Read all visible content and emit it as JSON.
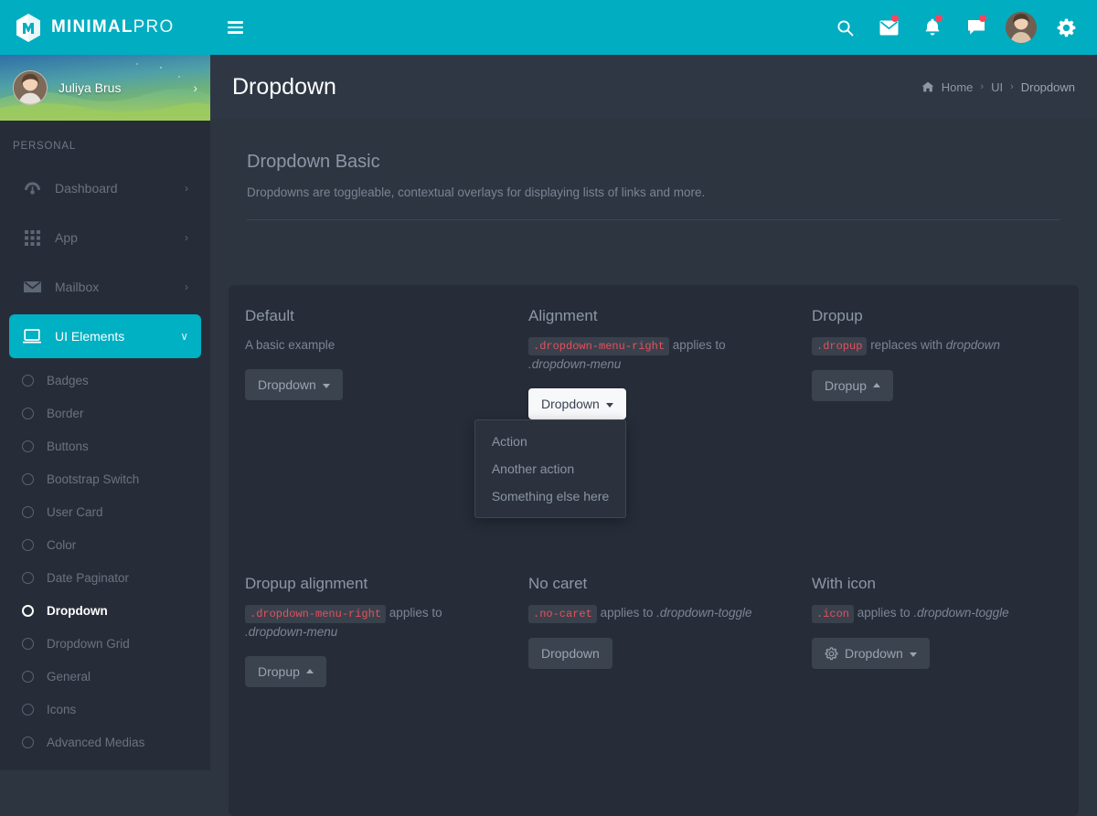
{
  "brand": {
    "primary": "MINIMAL",
    "secondary": "PRO",
    "logo_icon": "hexagon-m-logo"
  },
  "topbar": {
    "accent_color": "#00adc1",
    "badge_color": "#f8455f",
    "menu_toggle": "hamburger-icon",
    "actions": [
      {
        "name": "search-icon",
        "badge": false
      },
      {
        "name": "mail-icon",
        "badge": true
      },
      {
        "name": "bell-icon",
        "badge": true
      },
      {
        "name": "chat-icon",
        "badge": true
      }
    ],
    "avatar": "user-avatar",
    "settings_icon": "gear-icon"
  },
  "sidebar": {
    "user": {
      "name": "Juliya Brus",
      "chevron": "›"
    },
    "section_label": "PERSONAL",
    "items": [
      {
        "label": "Dashboard",
        "icon": "speedometer-icon",
        "arrow": "›",
        "active": false
      },
      {
        "label": "App",
        "icon": "grid-icon",
        "arrow": "›",
        "active": false
      },
      {
        "label": "Mailbox",
        "icon": "envelope-icon",
        "arrow": "›",
        "active": false
      },
      {
        "label": "UI Elements",
        "icon": "monitor-icon",
        "arrow": "∨",
        "active": true
      }
    ],
    "sub_items": [
      {
        "label": "Badges",
        "active": false
      },
      {
        "label": "Border",
        "active": false
      },
      {
        "label": "Buttons",
        "active": false
      },
      {
        "label": "Bootstrap Switch",
        "active": false
      },
      {
        "label": "User Card",
        "active": false
      },
      {
        "label": "Color",
        "active": false
      },
      {
        "label": "Date Paginator",
        "active": false
      },
      {
        "label": "Dropdown",
        "active": true
      },
      {
        "label": "Dropdown Grid",
        "active": false
      },
      {
        "label": "General",
        "active": false
      },
      {
        "label": "Icons",
        "active": false
      },
      {
        "label": "Advanced Medias",
        "active": false
      }
    ]
  },
  "page": {
    "title": "Dropdown",
    "breadcrumb": {
      "home_icon": "home-icon",
      "items": [
        "Home",
        "UI",
        "Dropdown"
      ],
      "separator": "›"
    },
    "card_title": "Dropdown Basic",
    "card_subtitle": "Dropdowns are toggleable, contextual overlays for displaying lists of links and more."
  },
  "demos": {
    "default": {
      "title": "Default",
      "desc": "A basic example",
      "button": "Dropdown",
      "caret": "down"
    },
    "alignment": {
      "title": "Alignment",
      "code": ".dropdown-menu-right",
      "desc_mid": "applies to",
      "desc_italic": ".dropdown-menu",
      "button": "Dropdown",
      "caret": "down",
      "open": true,
      "menu_items": [
        "Action",
        "Another action",
        "Something else here"
      ]
    },
    "dropup": {
      "title": "Dropup",
      "code": ".dropup",
      "desc_mid": "replaces with",
      "desc_italic": "dropdown",
      "button": "Dropup",
      "caret": "up"
    },
    "dropup_alignment": {
      "title": "Dropup alignment",
      "code": ".dropdown-menu-right",
      "desc_mid": "applies to",
      "desc_italic": ".dropdown-menu",
      "button": "Dropup",
      "caret": "up"
    },
    "no_caret": {
      "title": "No caret",
      "code": ".no-caret",
      "desc_mid": "applies to",
      "desc_italic": ".dropdown-toggle",
      "button": "Dropdown",
      "caret": "none"
    },
    "with_icon": {
      "title": "With icon",
      "code": ".icon",
      "desc_mid": "applies to",
      "desc_italic": ".dropdown-toggle",
      "button": "Dropdown",
      "icon": "gear-icon",
      "caret": "down"
    }
  }
}
